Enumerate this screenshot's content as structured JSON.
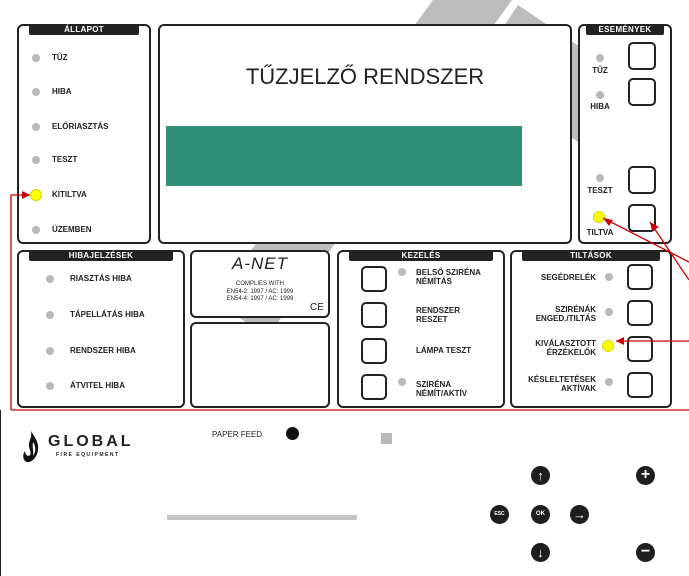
{
  "allapot": {
    "header": "ÁLLAPOT",
    "items": [
      {
        "label": "TŰZ",
        "led": "off"
      },
      {
        "label": "HIBA",
        "led": "off"
      },
      {
        "label": "ELŐRIASZTÁS",
        "led": "off"
      },
      {
        "label": "TESZT",
        "led": "off"
      },
      {
        "label": "KITILTVA",
        "led": "on"
      },
      {
        "label": "ÜZEMBEN",
        "led": "off"
      }
    ]
  },
  "display": {
    "title": "TŰZJELZŐ RENDSZER",
    "lcd_color": "#2f8f79"
  },
  "esemenyek": {
    "header": "ESEMÉNYEK",
    "items": [
      {
        "label": "TŰZ"
      },
      {
        "label": "HIBA"
      },
      {
        "label": "TESZT"
      },
      {
        "label": "TILTVA"
      }
    ]
  },
  "hibajelzesek": {
    "header": "HIBAJELZÉSEK",
    "items": [
      "RIASZTÁS HIBA",
      "TÁPELLÁTÁS HIBA",
      "RENDSZER HIBA",
      "ÁTVITEL HIBA"
    ]
  },
  "anet": {
    "title": "A-NET",
    "complies": "COMPLIES WITH",
    "std1": "EN54-2: 1997 / AC: 1999",
    "std2": "EN54-4: 1997 / AC: 1999",
    "ce": "CE"
  },
  "kezeles": {
    "header": "KEZELÉS",
    "items": [
      {
        "line1": "BELSŐ SZIRÉNA",
        "line2": "NÉMÍTÁS"
      },
      {
        "line1": "RENDSZER",
        "line2": "RESZET"
      },
      {
        "line1": "LÁMPA TESZT",
        "line2": ""
      },
      {
        "line1": "SZIRÉNA",
        "line2": "NÉMÍT/AKTÍV"
      }
    ]
  },
  "tiltasok": {
    "header": "TILTÁSOK",
    "items": [
      {
        "line1": "SEGÉDRELÉK",
        "line2": ""
      },
      {
        "line1": "SZIRÉNÁK",
        "line2": "ENGED./TILTÁS"
      },
      {
        "line1": "KIVÁLASZTOTT",
        "line2": "ÉRZÉKELŐK"
      },
      {
        "line1": "KÉSLELTETÉSEK",
        "line2": "AKTÍVAK"
      }
    ]
  },
  "brand": {
    "name": "GLOBAL",
    "tagline": "FIRE EQUIPMENT"
  },
  "paper_feed": "PAPER FEED",
  "nav": {
    "up": "↑",
    "down": "↓",
    "right": "→",
    "esc": "ESC",
    "ok": "OK",
    "plus": "+",
    "minus": "−"
  },
  "colors": {
    "led_off": "#b9b9b9",
    "led_on": "#ffff00",
    "callout": "#cc0000"
  }
}
